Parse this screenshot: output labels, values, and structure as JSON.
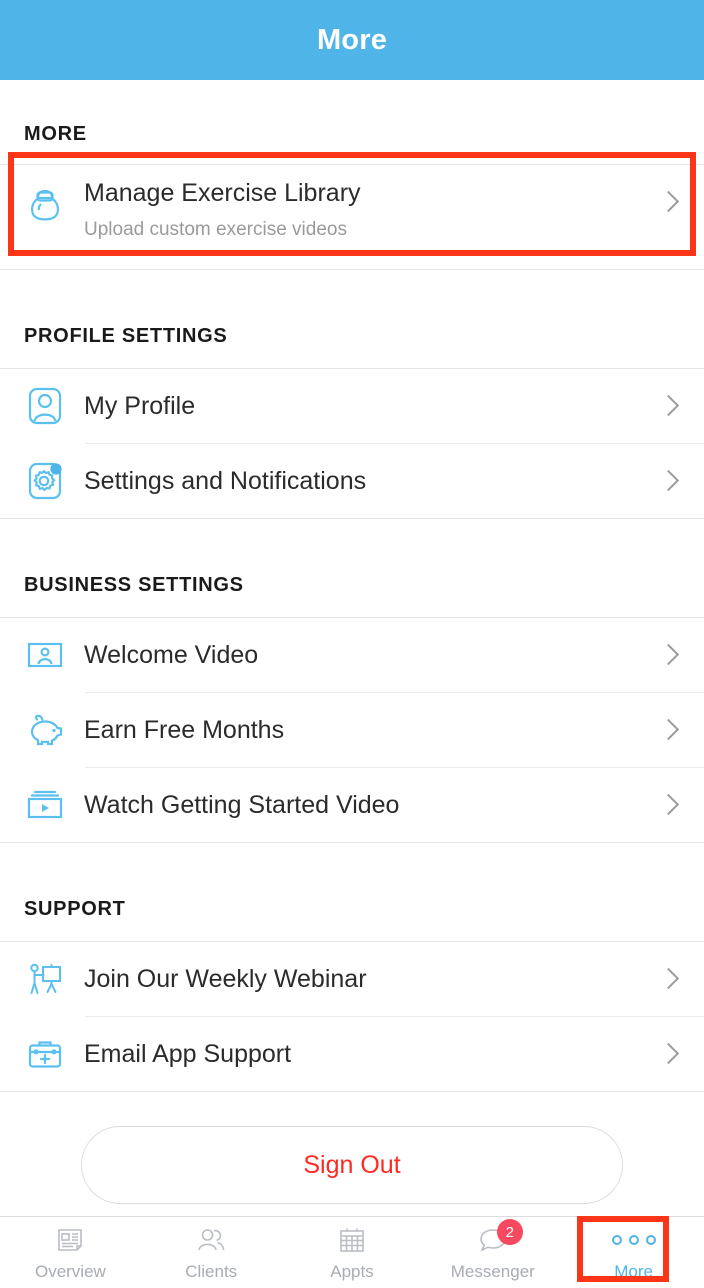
{
  "header": {
    "title": "More",
    "background": "#4FB4E8",
    "title_color": "#ffffff"
  },
  "highlight": {
    "color": "#FA3518"
  },
  "sections": [
    {
      "title": "MORE",
      "items": [
        {
          "label": "Manage Exercise Library",
          "subtitle": "Upload custom exercise videos",
          "icon": "kettlebell-icon"
        }
      ]
    },
    {
      "title": "PROFILE SETTINGS",
      "items": [
        {
          "label": "My Profile",
          "icon": "profile-person-icon"
        },
        {
          "label": "Settings and Notifications",
          "icon": "gear-icon",
          "badge_dot": true
        }
      ]
    },
    {
      "title": "BUSINESS SETTINGS",
      "items": [
        {
          "label": "Welcome Video",
          "icon": "person-frame-icon"
        },
        {
          "label": "Earn Free Months",
          "icon": "piggy-bank-icon"
        },
        {
          "label": "Watch Getting Started Video",
          "icon": "video-player-icon"
        }
      ]
    },
    {
      "title": "SUPPORT",
      "items": [
        {
          "label": "Join Our Weekly Webinar",
          "icon": "presenter-whiteboard-icon"
        },
        {
          "label": "Email App Support",
          "icon": "first-aid-kit-icon"
        }
      ]
    }
  ],
  "signout": {
    "label": "Sign Out",
    "color": "#FF2A21"
  },
  "tabbar": {
    "items": [
      {
        "label": "Overview",
        "icon": "newspaper-icon",
        "active": false
      },
      {
        "label": "Clients",
        "icon": "people-icon",
        "active": false
      },
      {
        "label": "Appts",
        "icon": "calendar-icon",
        "active": false
      },
      {
        "label": "Messenger",
        "icon": "chat-bubble-icon",
        "active": false,
        "badge": "2"
      },
      {
        "label": "More",
        "icon": "three-dots-icon",
        "active": true
      }
    ],
    "active_color": "#4FB4E8",
    "badge_color": "#F5495F"
  }
}
